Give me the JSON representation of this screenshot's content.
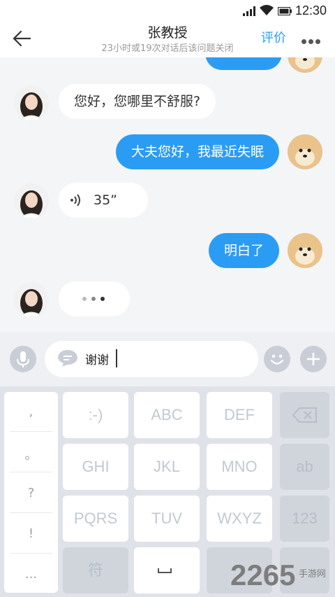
{
  "status_bar": {
    "time": "12:30"
  },
  "header": {
    "title": "张教授",
    "subtitle": "23小时或19次对话后该问题关闭",
    "rate_label": "评价"
  },
  "messages": [
    {
      "side": "left",
      "sender": "doctor",
      "type": "text",
      "text": "您好，您哪里不舒服?"
    },
    {
      "side": "right",
      "sender": "user",
      "type": "text",
      "text": "大夫您好，我最近失眠"
    },
    {
      "side": "left",
      "sender": "doctor",
      "type": "voice",
      "text": "35”"
    },
    {
      "side": "right",
      "sender": "user",
      "type": "text",
      "text": "明白了"
    },
    {
      "side": "left",
      "sender": "doctor",
      "type": "typing",
      "text": ""
    }
  ],
  "input": {
    "value": "谢谢"
  },
  "keyboard": {
    "punctuation": [
      ",",
      "。",
      "?",
      "!",
      "..."
    ],
    "keys": [
      [
        ":-)",
        "ABC",
        "DEF"
      ],
      [
        "GHI",
        "JKL",
        "MNO"
      ],
      [
        "PQRS",
        "TUV",
        "WXYZ"
      ]
    ],
    "side_keys": [
      "backspace-icon",
      "ab",
      "123",
      "return-icon"
    ],
    "symbol_key": "符"
  },
  "watermark": {
    "text": "2265",
    "sub": "手游网"
  },
  "colors": {
    "accent": "#2b9cf3",
    "bubble_left": "#ffffff",
    "background": "#f4f5f7"
  }
}
